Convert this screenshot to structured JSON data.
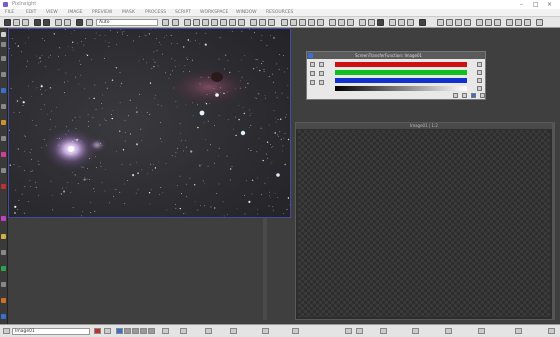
{
  "window": {
    "title": "PixInsight"
  },
  "menu": [
    "FILE",
    "EDIT",
    "VIEW",
    "IMAGE",
    "PREVIEW",
    "MASK",
    "PROCESS",
    "SCRIPT",
    "WORKSPACE",
    "WINDOW",
    "RESOURCES"
  ],
  "toolbar": {
    "zoom_select": "Auto"
  },
  "curves_window": {
    "title": "ScreenTransferFunction: Image01"
  },
  "histogram_window": {
    "title": "Image01 | 1:2"
  },
  "statusbar": {
    "view_selector": "Image01"
  },
  "colors": {
    "red": "#d01010",
    "green": "#10c020",
    "blue": "#1030d0",
    "accent": "#4848a0"
  }
}
